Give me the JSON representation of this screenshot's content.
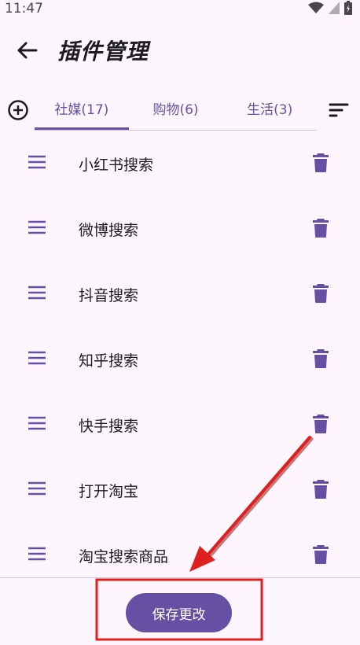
{
  "status_bar": {
    "time": "11:47",
    "icons": [
      "wifi-icon",
      "signal-icon",
      "battery-icon"
    ]
  },
  "app_bar": {
    "back_icon": "arrow-left-icon",
    "title": "插件管理"
  },
  "tab_bar": {
    "add_icon": "add-circle-icon",
    "sort_icon": "sort-icon",
    "tabs": [
      {
        "label": "社媒(17)",
        "active": true
      },
      {
        "label": "购物(6)",
        "active": false
      },
      {
        "label": "生活(3)",
        "active": false
      }
    ]
  },
  "plugins": [
    {
      "label": "小红书搜索"
    },
    {
      "label": "微博搜索"
    },
    {
      "label": "抖音搜索"
    },
    {
      "label": "知乎搜索"
    },
    {
      "label": "快手搜索"
    },
    {
      "label": "打开淘宝"
    },
    {
      "label": "淘宝搜索商品"
    }
  ],
  "save_button": {
    "label": "保存更改"
  },
  "colors": {
    "accent": "#6750a4",
    "background": "#fdf7fd",
    "annotation": "#e02020"
  }
}
